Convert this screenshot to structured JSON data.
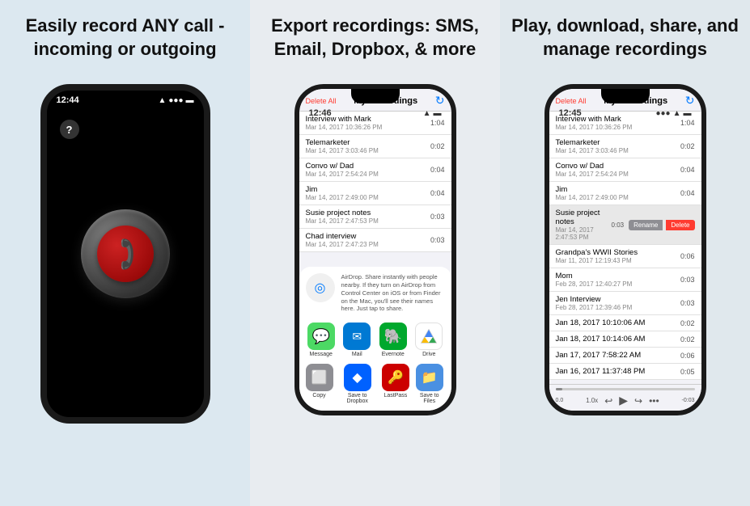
{
  "panels": [
    {
      "id": "panel-1",
      "title": "Easily record ANY call - incoming or outgoing",
      "phone": {
        "time": "12:44",
        "has_question": true,
        "record_button": true
      }
    },
    {
      "id": "panel-2",
      "title": "Export recordings: SMS, Email, Dropbox, & more",
      "phone": {
        "time": "12:46",
        "nav": {
          "delete": "Delete All",
          "title": "My Recordings",
          "refresh": "↻"
        },
        "recordings": [
          {
            "name": "Interview with Mark",
            "date": "Mar 14, 2017 10:36:26 PM",
            "duration": "1:04"
          },
          {
            "name": "Telemarketer",
            "date": "Mar 14, 2017 3:03:46 PM",
            "duration": "0:02"
          },
          {
            "name": "Convo w/ Dad",
            "date": "Mar 14, 2017 2:54:24 PM",
            "duration": "0:04"
          },
          {
            "name": "Jim",
            "date": "Mar 14, 2017 2:49:00 PM",
            "duration": "0:04"
          },
          {
            "name": "Susie project notes",
            "date": "Mar 14, 2017 2:47:53 PM",
            "duration": "0:03"
          },
          {
            "name": "Chad interview",
            "date": "Mar 14, 2017 2:47:23 PM",
            "duration": "0:03"
          }
        ],
        "share": {
          "airdrop_text": "AirDrop. Share instantly with people nearby. If they turn on AirDrop from Control Center on iOS or from Finder on the Mac, you'll see their names here. Just tap to share.",
          "apps": [
            {
              "label": "Message",
              "color": "#4cd964",
              "icon": "💬"
            },
            {
              "label": "Mail",
              "color": "#0079d3",
              "icon": "✉️"
            },
            {
              "label": "Evernote",
              "color": "#00a82d",
              "icon": "🐘"
            },
            {
              "label": "Drive",
              "color": "#fff",
              "icon": "▲"
            }
          ],
          "apps2": [
            {
              "label": "Copy",
              "color": "#8e8e93",
              "icon": "📋"
            },
            {
              "label": "Save to Dropbox",
              "color": "#0061ff",
              "icon": "📦"
            },
            {
              "label": "LastPass",
              "color": "#cc0000",
              "icon": "🔑"
            },
            {
              "label": "Save to Files",
              "color": "#4a90e2",
              "icon": "📁"
            }
          ]
        }
      }
    },
    {
      "id": "panel-3",
      "title": "Play, download, share, and manage recordings",
      "phone": {
        "time": "12:45",
        "nav": {
          "delete": "Delete All",
          "title": "My Recordings",
          "refresh": "↻"
        },
        "recordings": [
          {
            "name": "Interview with Mark",
            "date": "Mar 14, 2017 10:36:26 PM",
            "duration": "1:04"
          },
          {
            "name": "Telemarketer",
            "date": "Mar 14, 2017 3:03:46 PM",
            "duration": "0:02"
          },
          {
            "name": "Convo w/ Dad",
            "date": "Mar 14, 2017 2:54:24 PM",
            "duration": "0:04"
          },
          {
            "name": "Jim",
            "date": "Mar 14, 2017 2:49:00 PM",
            "duration": "0:04"
          },
          {
            "name": "Susie project notes (highlighted)",
            "date": "Mar 14, 2017 2:47:53 PM",
            "duration": "0:03",
            "highlight": true
          }
        ],
        "more_recordings": [
          {
            "name": "Grandpa's WWII Stories",
            "date": "Mar 11, 2017 12:19:43 PM",
            "duration": "0:06"
          },
          {
            "name": "Mom",
            "date": "Feb 28, 2017 12:40:27 PM",
            "duration": "0:03"
          },
          {
            "name": "Jen Interview",
            "date": "Feb 28, 2017 12:39:46 PM",
            "duration": "0:03"
          },
          {
            "name": "Jan 18, 2017 10:10:06 AM",
            "date": "",
            "duration": "0:02"
          },
          {
            "name": "Jan 18, 2017 10:14:06 AM",
            "date": "",
            "duration": "0:02"
          },
          {
            "name": "Jan 17, 2017 7:58:22 AM",
            "date": "",
            "duration": "0:06"
          },
          {
            "name": "Jan 16, 2017 11:37:48 PM",
            "date": "",
            "duration": "0:05"
          }
        ],
        "player": {
          "time_left": "0.0",
          "time_right": "-0:03",
          "speed": "1.0x"
        }
      }
    }
  ]
}
